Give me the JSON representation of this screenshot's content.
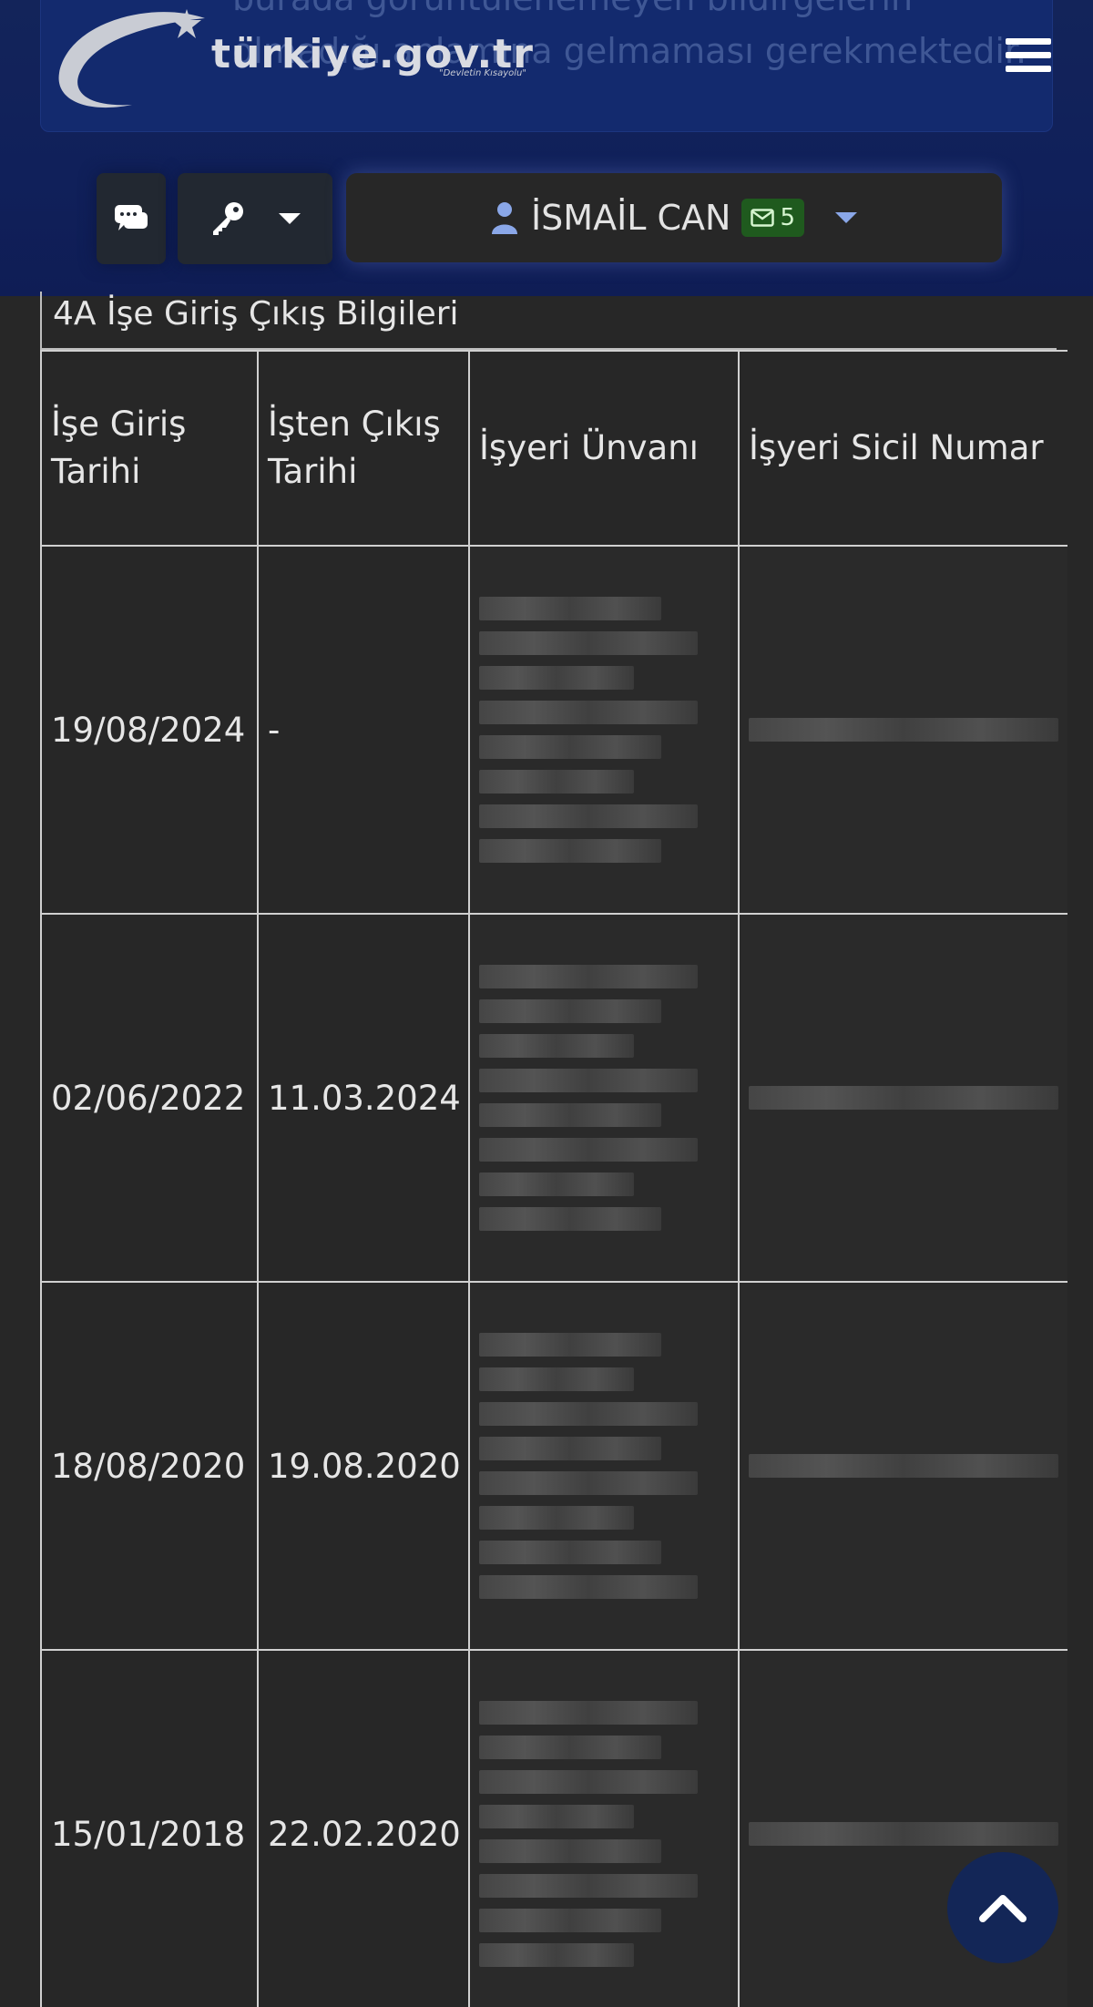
{
  "header": {
    "notice_text": "burada görüntülenemeyen bildirgelerin olmadığı anlamına gelmaması gerekmektedir.",
    "logo_text": "türkiye.gov.tr",
    "logo_tagline": "\"Devletin Kısayolu\""
  },
  "user": {
    "name": "İSMAİL CAN",
    "unread_count": "5"
  },
  "section": {
    "title": "4A İşe Giriş Çıkış Bilgileri"
  },
  "table": {
    "headers": [
      "İşe Giriş Tarihi",
      "İşten Çıkış Tarihi",
      "İşyeri Ünvanı",
      "İşyeri Sicil Numar"
    ],
    "rows": [
      {
        "giris": "19/08/2024",
        "cikis": "-"
      },
      {
        "giris": "02/06/2022",
        "cikis": "11.03.2024"
      },
      {
        "giris": "18/08/2020",
        "cikis": "19.08.2020"
      },
      {
        "giris": "15/01/2018",
        "cikis": "22.02.2020"
      }
    ]
  },
  "icons": {
    "chat": "chat-icon",
    "key": "key-icon",
    "user": "user-icon",
    "mail": "envelope-icon",
    "menu": "hamburger-icon",
    "scroll_top": "chevron-up-icon"
  },
  "colors": {
    "header_bg": "#10205a",
    "page_bg": "#272727",
    "badge_bg": "#1f5a1e",
    "user_icon": "#8aa7e8"
  }
}
